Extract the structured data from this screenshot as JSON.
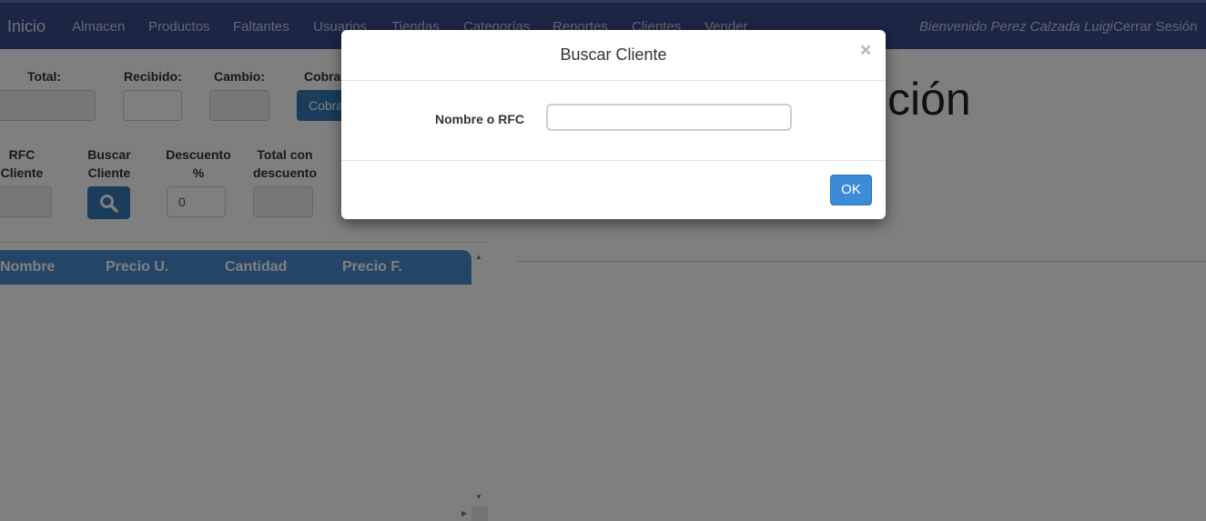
{
  "navbar": {
    "brand": "Inicio",
    "items": [
      "Almacen",
      "Productos",
      "Faltantes",
      "Usuarios",
      "Tiendas",
      "Categorías",
      "Reportes",
      "Clientes",
      "Vender"
    ],
    "welcome": "Bienvenido Perez Calzada Luigi",
    "logout": "Cerrar Sesión"
  },
  "payment": {
    "total_label": "Total:",
    "recibido_label": "Recibido:",
    "cambio_label": "Cambio:",
    "cobrar_label": "Cobra",
    "cobrar_button": "Cobrar"
  },
  "client": {
    "rfc_label_1": "RFC",
    "rfc_label_2": "Cliente",
    "buscar_label_1": "Buscar",
    "buscar_label_2": "Cliente",
    "descuento_label_1": "Descuento",
    "descuento_label_2": "%",
    "descuento_value": "0",
    "total_desc_label_1": "Total con",
    "total_desc_label_2": "descuento"
  },
  "table": {
    "columns": [
      "Nombre",
      "Precio U.",
      "Cantidad",
      "Precio F."
    ]
  },
  "main": {
    "title_partial": "ción"
  },
  "modal": {
    "title": "Buscar Cliente",
    "close": "×",
    "field_label": "Nombre o RFC",
    "field_value": "",
    "ok_button": "OK"
  }
}
